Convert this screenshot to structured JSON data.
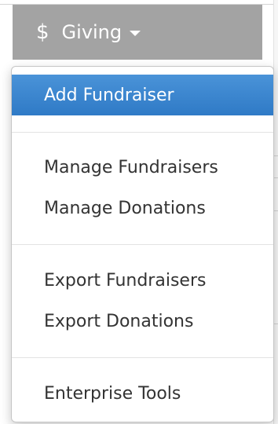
{
  "giving_button": {
    "icon": "dollar-icon",
    "icon_glyph": "$",
    "label": "Giving",
    "caret_icon": "caret-down-icon"
  },
  "menu": {
    "items": [
      {
        "label": "Add Fundraiser",
        "active": true
      },
      {
        "label": "Manage Fundraisers"
      },
      {
        "label": "Manage Donations"
      },
      {
        "label": "Export Fundraisers"
      },
      {
        "label": "Export Donations"
      },
      {
        "label": "Enterprise Tools"
      }
    ]
  },
  "colors": {
    "button_bg": "#a3a3a3",
    "active_item_bg": "#3a85cf",
    "text": "#333333"
  }
}
